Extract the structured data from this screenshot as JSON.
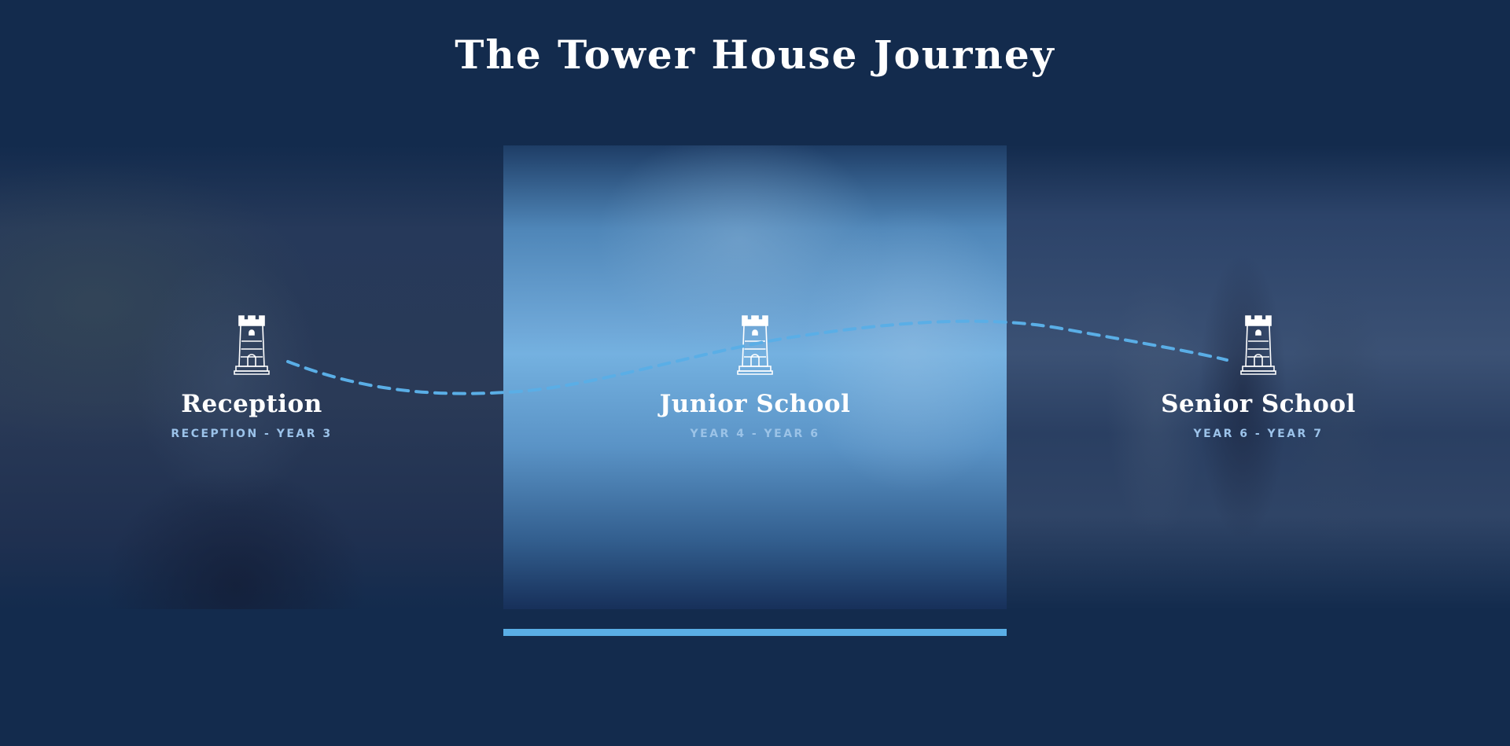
{
  "page": {
    "title": "The Tower House Journey"
  },
  "stages": [
    {
      "title": "Reception",
      "subtitle": "RECEPTION - YEAR 3",
      "icon": "tower-icon"
    },
    {
      "title": "Junior School",
      "subtitle": "YEAR 4 - YEAR 6",
      "icon": "tower-icon"
    },
    {
      "title": "Senior School",
      "subtitle": "YEAR 6 - YEAR 7",
      "icon": "tower-icon"
    }
  ],
  "active_stage": 1,
  "colors": {
    "background": "#132b4d",
    "accent": "#5aaee6",
    "subtitle": "#9cc3ea",
    "text": "#ffffff"
  }
}
